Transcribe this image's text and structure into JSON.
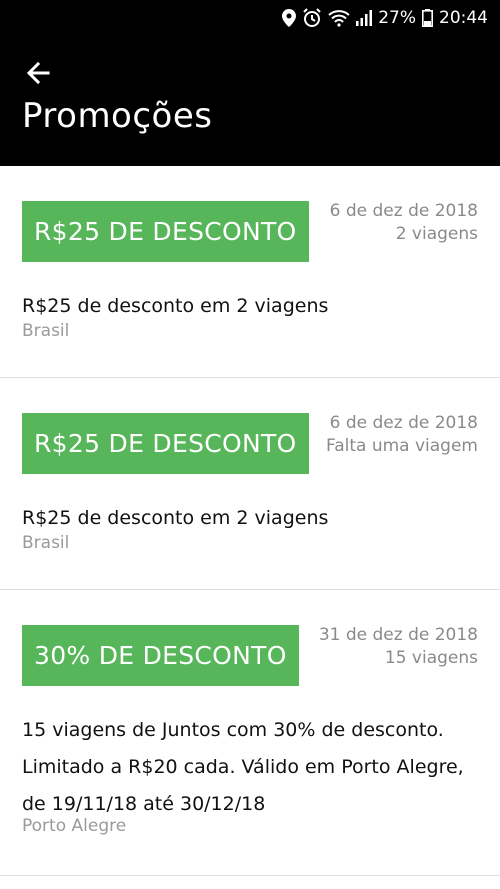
{
  "status_bar": {
    "battery": "27%",
    "time": "20:44"
  },
  "header": {
    "title": "Promoções"
  },
  "promotions": [
    {
      "badge": "R$25 DE DESCONTO",
      "date": "6 de dez de 2018",
      "trips": "2 viagens",
      "description": "R$25 de desconto em 2 viagens",
      "region": "Brasil"
    },
    {
      "badge": "R$25 DE DESCONTO",
      "date": "6 de dez de 2018",
      "trips": "Falta uma viagem",
      "description": "R$25 de desconto em 2 viagens",
      "region": "Brasil"
    },
    {
      "badge": "30% DE DESCONTO",
      "date": "31 de dez de 2018",
      "trips": "15 viagens",
      "description": "15 viagens de Juntos com 30% de desconto. Limitado a R$20 cada. Válido em Porto Alegre, de 19/11/18 até 30/12/18",
      "region": "Porto Alegre"
    }
  ],
  "colors": {
    "header_bg": "#000000",
    "badge_bg": "#58b65a",
    "meta_text": "#8a8a8a"
  }
}
